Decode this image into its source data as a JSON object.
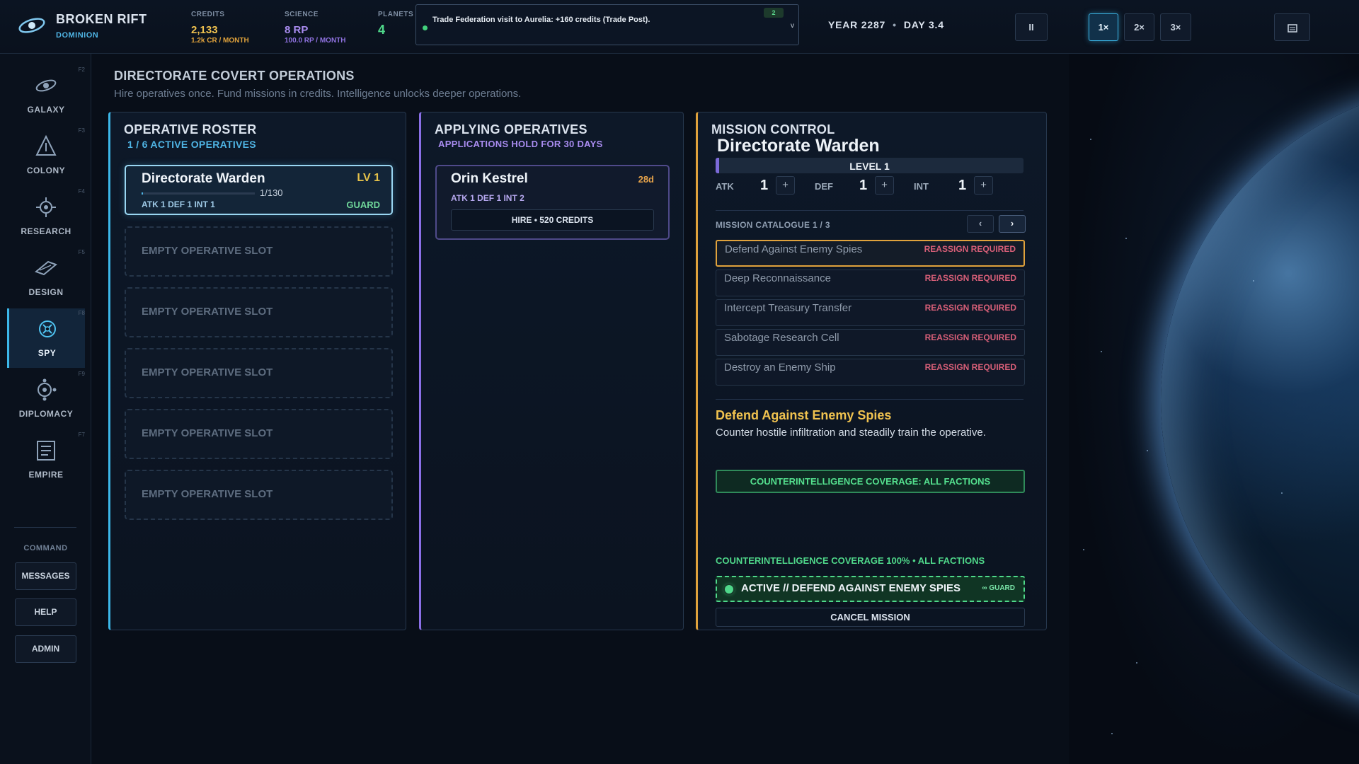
{
  "brand": {
    "title": "BROKEN RIFT",
    "subtitle": "DOMINION"
  },
  "stats": {
    "credits": {
      "label": "CREDITS",
      "value": "2,133",
      "rate": "1.2k CR / MONTH"
    },
    "science": {
      "label": "SCIENCE",
      "value": "8 RP",
      "rate": "100.0 RP / MONTH"
    },
    "planets": {
      "label": "PLANETS",
      "value": "4"
    }
  },
  "notification": {
    "message": "Trade Federation visit to Aurelia: +160 credits (Trade Post).",
    "count": "2",
    "chevron": "v"
  },
  "date": {
    "year": "YEAR 2287",
    "day": "DAY 3.4"
  },
  "speed": {
    "pause": "II",
    "speeds": [
      "1×",
      "2×",
      "3×"
    ],
    "active": "1×"
  },
  "menu_icon": "menu-icon",
  "sidebar": {
    "items": [
      {
        "label": "GALAXY",
        "key": "F2",
        "icon": "galaxy-icon"
      },
      {
        "label": "COLONY",
        "key": "F3",
        "icon": "colony-icon"
      },
      {
        "label": "RESEARCH",
        "key": "F4",
        "icon": "research-icon"
      },
      {
        "label": "DESIGN",
        "key": "F5",
        "icon": "design-icon"
      },
      {
        "label": "SPY",
        "key": "F8",
        "icon": "spy-icon",
        "active": true
      },
      {
        "label": "DIPLOMACY",
        "key": "F9",
        "icon": "diplomacy-icon"
      },
      {
        "label": "EMPIRE",
        "key": "F7",
        "icon": "empire-icon"
      }
    ],
    "command_label": "COMMAND",
    "commands": [
      "MESSAGES",
      "HELP",
      "ADMIN"
    ]
  },
  "page": {
    "title": "DIRECTORATE COVERT OPERATIONS",
    "subtitle": "Hire operatives once. Fund missions in credits. Intelligence unlocks deeper operations."
  },
  "roster": {
    "title": "OPERATIVE ROSTER",
    "subtitle": "1 / 6 ACTIVE OPERATIVES",
    "operative": {
      "name": "Directorate Warden",
      "level": "LV 1",
      "xp": "1/130",
      "xp_fraction": 0.008,
      "stats": "ATK 1  DEF 1  INT 1",
      "role": "GUARD"
    },
    "empty_slots": [
      "EMPTY OPERATIVE SLOT",
      "EMPTY OPERATIVE SLOT",
      "EMPTY OPERATIVE SLOT",
      "EMPTY OPERATIVE SLOT",
      "EMPTY OPERATIVE SLOT"
    ]
  },
  "applying": {
    "title": "APPLYING OPERATIVES",
    "subtitle": "APPLICATIONS HOLD FOR 30 DAYS",
    "applicant": {
      "name": "Orin Kestrel",
      "days": "28d",
      "stats": "ATK 1  DEF 1  INT 2",
      "hire_label": "HIRE  •  520 CREDITS"
    }
  },
  "mission": {
    "title": "MISSION CONTROL",
    "operative_name": "Directorate Warden",
    "level": "LEVEL 1",
    "level_progress": 0.01,
    "attributes": [
      {
        "label": "ATK",
        "value": "1",
        "plus": "+"
      },
      {
        "label": "DEF",
        "value": "1",
        "plus": "+"
      },
      {
        "label": "INT",
        "value": "1",
        "plus": "+"
      }
    ],
    "catalogue_label": "MISSION CATALOGUE 1 / 3",
    "prev": "‹",
    "next": "›",
    "missions": [
      {
        "name": "Defend Against Enemy Spies",
        "status": "REASSIGN REQUIRED",
        "selected": true
      },
      {
        "name": "Deep Reconnaissance",
        "status": "REASSIGN REQUIRED"
      },
      {
        "name": "Intercept Treasury Transfer",
        "status": "REASSIGN REQUIRED"
      },
      {
        "name": "Sabotage Research Cell",
        "status": "REASSIGN REQUIRED"
      },
      {
        "name": "Destroy an Enemy Ship",
        "status": "REASSIGN REQUIRED"
      }
    ],
    "detail_title": "Defend Against Enemy Spies",
    "detail_desc": "Counter hostile infiltration and steadily train the operative.",
    "coverage_button": "COUNTERINTELLIGENCE COVERAGE: ALL FACTIONS",
    "coverage_summary": "COUNTERINTELLIGENCE COVERAGE 100% • ALL FACTIONS",
    "active_label": "ACTIVE // DEFEND AGAINST ENEMY SPIES",
    "active_tag": "∞ GUARD",
    "cancel_label": "CANCEL MISSION"
  }
}
